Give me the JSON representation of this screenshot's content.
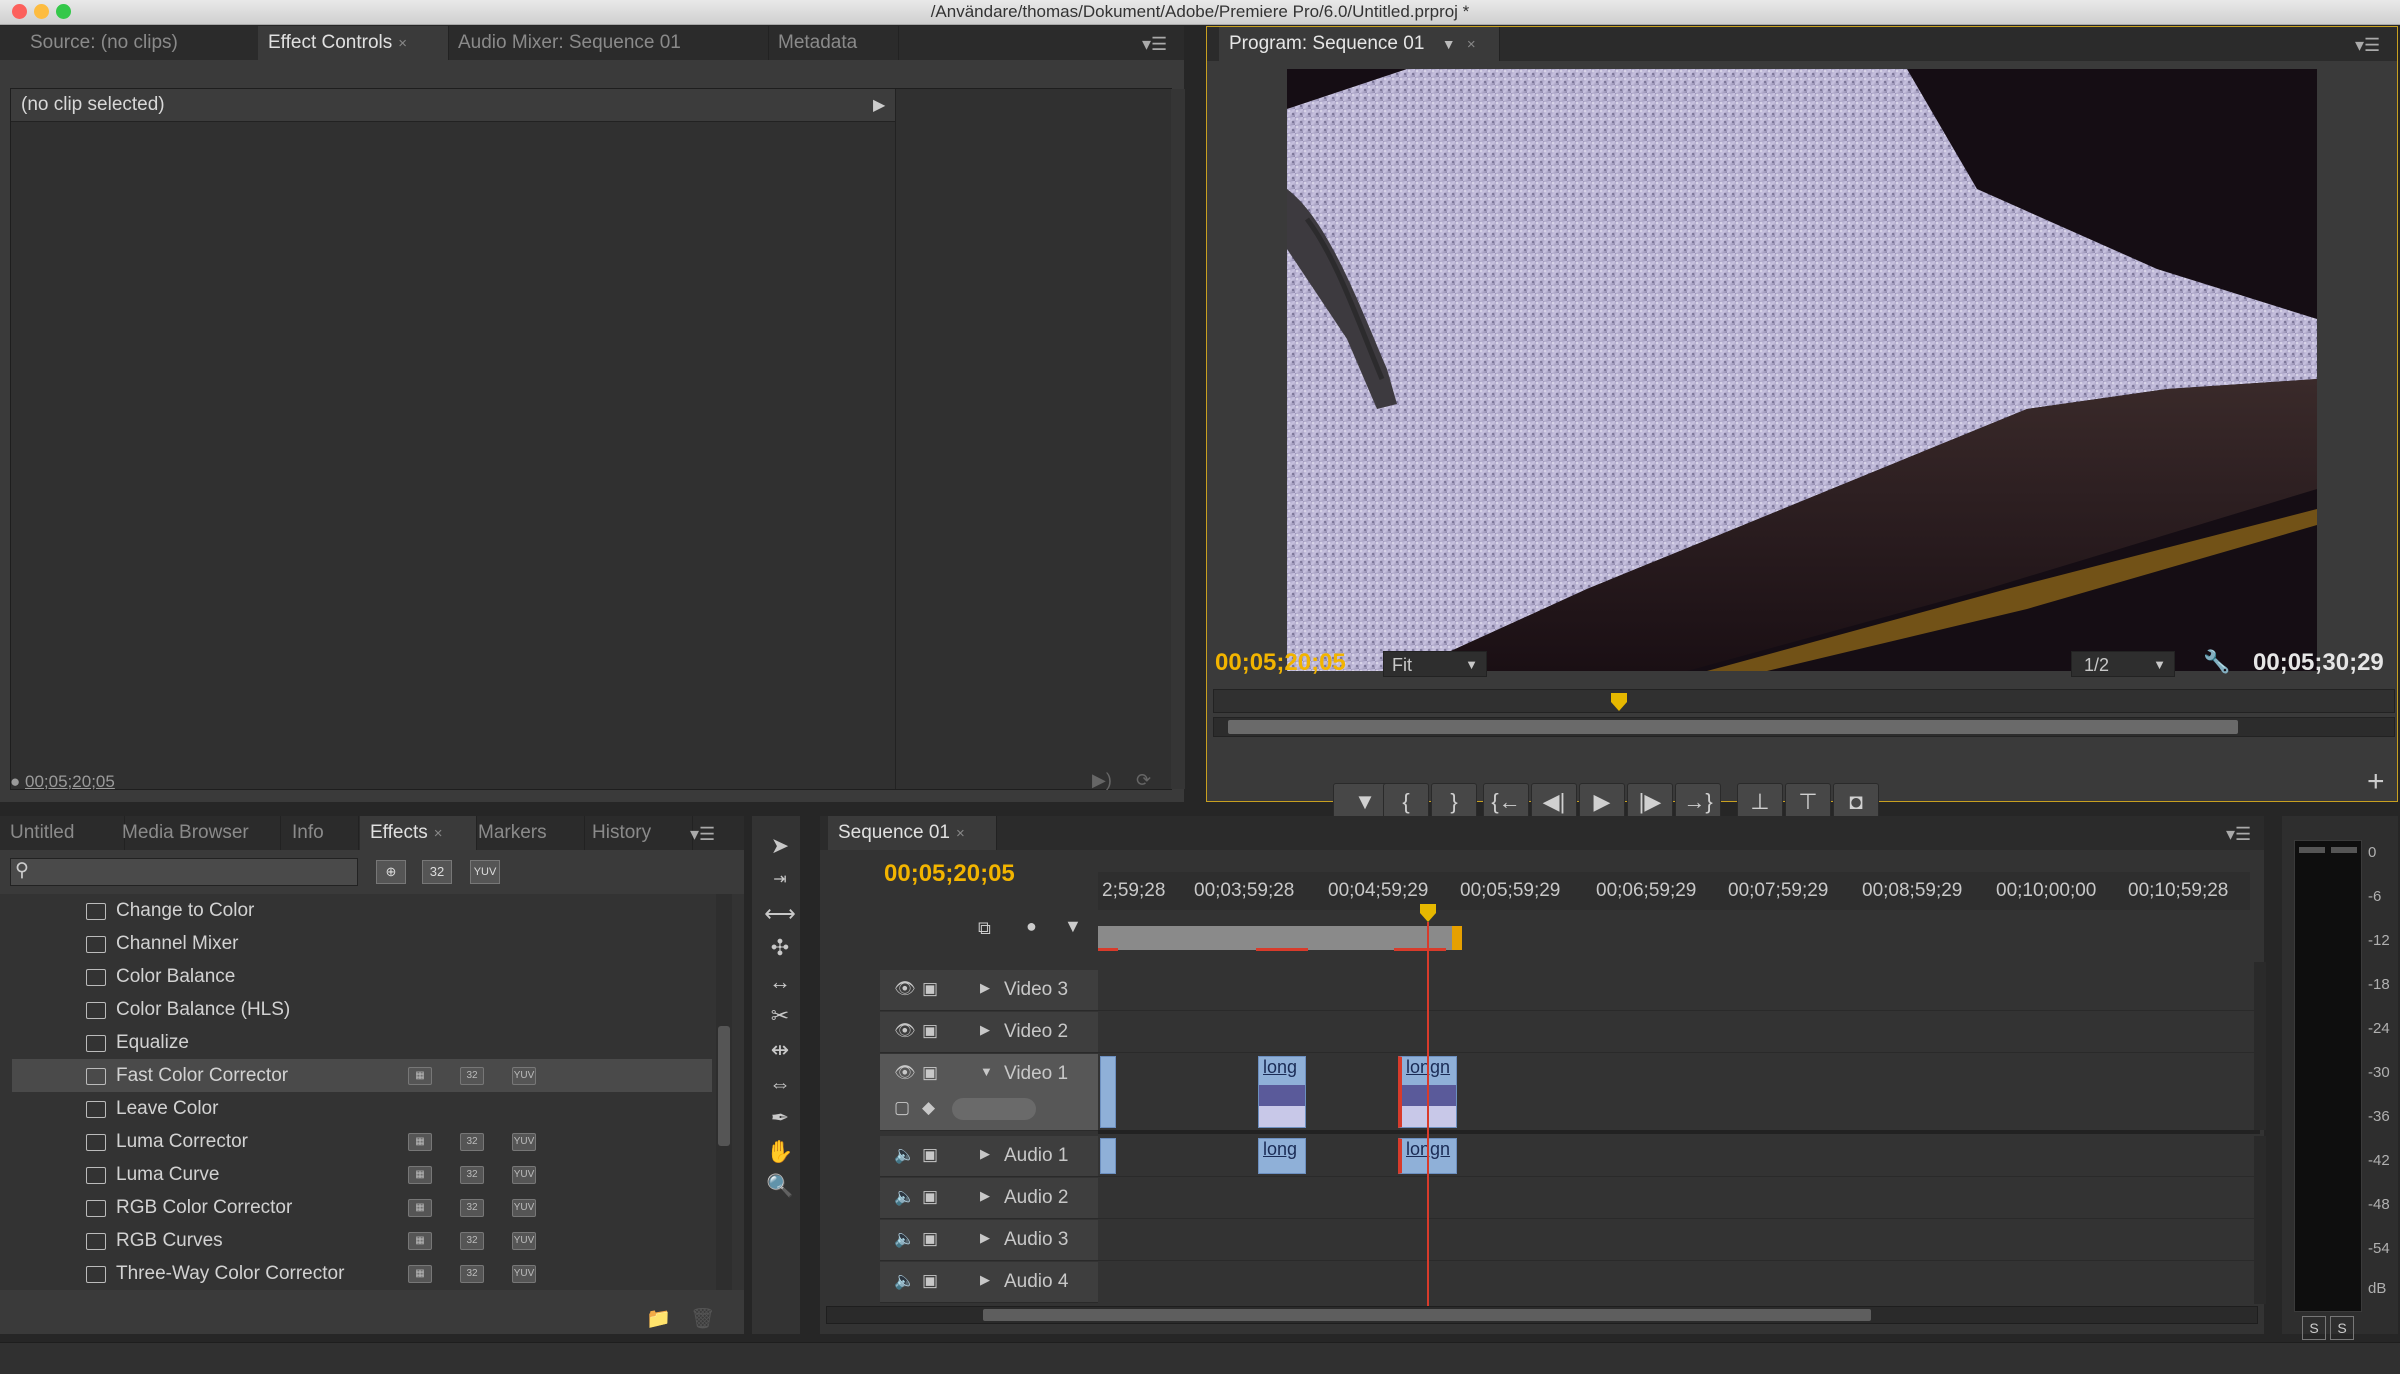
{
  "window": {
    "title": "/Användare/thomas/Dokument/Adobe/Premiere Pro/6.0/Untitled.prproj *"
  },
  "top_left_panel": {
    "tabs": [
      "Source: (no clips)",
      "Effect Controls",
      "Audio Mixer: Sequence 01",
      "Metadata"
    ],
    "active_tab": "Effect Controls",
    "clip_status": "(no clip selected)",
    "timecode": "00;05;20;05"
  },
  "program_monitor": {
    "tab": "Program: Sequence 01",
    "current_timecode": "00;05;20;05",
    "zoom": "Fit",
    "resolution": "1/2",
    "duration": "00;05;30;29",
    "buttons": [
      "add-marker",
      "mark-in",
      "mark-out",
      "go-to-in",
      "step-back",
      "play",
      "step-forward",
      "go-to-out",
      "lift",
      "extract",
      "export-frame"
    ]
  },
  "project_panel": {
    "tabs": [
      "Untitled",
      "Media Browser",
      "Info",
      "Effects",
      "Markers",
      "History"
    ],
    "active_tab": "Effects",
    "search_value": "",
    "filter_badges": [
      "32",
      "YUV"
    ],
    "effects": [
      {
        "name": "Change to Color",
        "badges": false
      },
      {
        "name": "Channel Mixer",
        "badges": false
      },
      {
        "name": "Color Balance",
        "badges": false
      },
      {
        "name": "Color Balance (HLS)",
        "badges": false
      },
      {
        "name": "Equalize",
        "badges": false
      },
      {
        "name": "Fast Color Corrector",
        "badges": true
      },
      {
        "name": "Leave Color",
        "badges": false
      },
      {
        "name": "Luma Corrector",
        "badges": true
      },
      {
        "name": "Luma Curve",
        "badges": true
      },
      {
        "name": "RGB Color Corrector",
        "badges": true
      },
      {
        "name": "RGB Curves",
        "badges": true
      },
      {
        "name": "Three-Way Color Corrector",
        "badges": true
      }
    ],
    "selected_effect": "Fast Color Corrector"
  },
  "timeline": {
    "tab": "Sequence 01",
    "timecode": "00;05;20;05",
    "ruler": [
      "2;59;28",
      "00;03;59;28",
      "00;04;59;29",
      "00;05;59;29",
      "00;06;59;29",
      "00;07;59;29",
      "00;08;59;29",
      "00;10;00;00",
      "00;10;59;28"
    ],
    "tracks": [
      {
        "name": "Video 3"
      },
      {
        "name": "Video 2"
      },
      {
        "name": "Video 1"
      },
      {
        "name": "Audio 1"
      },
      {
        "name": "Audio 2"
      },
      {
        "name": "Audio 3"
      },
      {
        "name": "Audio 4"
      }
    ],
    "clip_labels": [
      "long",
      "longn",
      "long",
      "longn"
    ]
  },
  "audio_meter": {
    "scale": [
      "0",
      "-6",
      "-12",
      "-18",
      "-24",
      "-30",
      "-36",
      "-42",
      "-48",
      "-54",
      "dB"
    ],
    "solo_buttons": [
      "S",
      "S"
    ]
  },
  "colors": {
    "accent": "#f2b400",
    "panel": "#3a3a3a",
    "playhead": "#d83b2b",
    "clip": "#8fb0d8"
  }
}
